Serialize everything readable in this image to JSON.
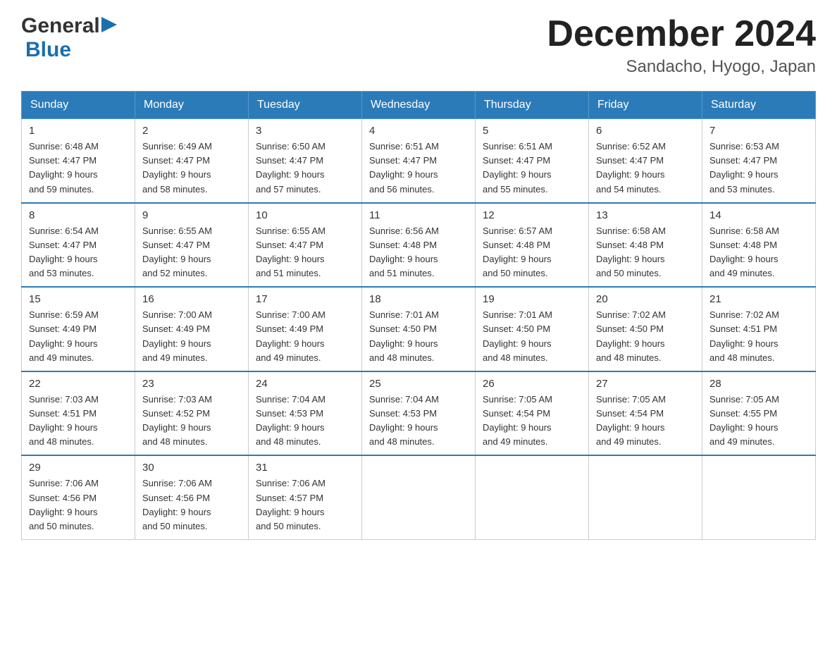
{
  "header": {
    "logo_general": "General",
    "logo_blue": "Blue",
    "month_title": "December 2024",
    "location": "Sandacho, Hyogo, Japan"
  },
  "weekdays": [
    "Sunday",
    "Monday",
    "Tuesday",
    "Wednesday",
    "Thursday",
    "Friday",
    "Saturday"
  ],
  "weeks": [
    [
      {
        "day": "1",
        "sunrise": "6:48 AM",
        "sunset": "4:47 PM",
        "daylight": "9 hours and 59 minutes."
      },
      {
        "day": "2",
        "sunrise": "6:49 AM",
        "sunset": "4:47 PM",
        "daylight": "9 hours and 58 minutes."
      },
      {
        "day": "3",
        "sunrise": "6:50 AM",
        "sunset": "4:47 PM",
        "daylight": "9 hours and 57 minutes."
      },
      {
        "day": "4",
        "sunrise": "6:51 AM",
        "sunset": "4:47 PM",
        "daylight": "9 hours and 56 minutes."
      },
      {
        "day": "5",
        "sunrise": "6:51 AM",
        "sunset": "4:47 PM",
        "daylight": "9 hours and 55 minutes."
      },
      {
        "day": "6",
        "sunrise": "6:52 AM",
        "sunset": "4:47 PM",
        "daylight": "9 hours and 54 minutes."
      },
      {
        "day": "7",
        "sunrise": "6:53 AM",
        "sunset": "4:47 PM",
        "daylight": "9 hours and 53 minutes."
      }
    ],
    [
      {
        "day": "8",
        "sunrise": "6:54 AM",
        "sunset": "4:47 PM",
        "daylight": "9 hours and 53 minutes."
      },
      {
        "day": "9",
        "sunrise": "6:55 AM",
        "sunset": "4:47 PM",
        "daylight": "9 hours and 52 minutes."
      },
      {
        "day": "10",
        "sunrise": "6:55 AM",
        "sunset": "4:47 PM",
        "daylight": "9 hours and 51 minutes."
      },
      {
        "day": "11",
        "sunrise": "6:56 AM",
        "sunset": "4:48 PM",
        "daylight": "9 hours and 51 minutes."
      },
      {
        "day": "12",
        "sunrise": "6:57 AM",
        "sunset": "4:48 PM",
        "daylight": "9 hours and 50 minutes."
      },
      {
        "day": "13",
        "sunrise": "6:58 AM",
        "sunset": "4:48 PM",
        "daylight": "9 hours and 50 minutes."
      },
      {
        "day": "14",
        "sunrise": "6:58 AM",
        "sunset": "4:48 PM",
        "daylight": "9 hours and 49 minutes."
      }
    ],
    [
      {
        "day": "15",
        "sunrise": "6:59 AM",
        "sunset": "4:49 PM",
        "daylight": "9 hours and 49 minutes."
      },
      {
        "day": "16",
        "sunrise": "7:00 AM",
        "sunset": "4:49 PM",
        "daylight": "9 hours and 49 minutes."
      },
      {
        "day": "17",
        "sunrise": "7:00 AM",
        "sunset": "4:49 PM",
        "daylight": "9 hours and 49 minutes."
      },
      {
        "day": "18",
        "sunrise": "7:01 AM",
        "sunset": "4:50 PM",
        "daylight": "9 hours and 48 minutes."
      },
      {
        "day": "19",
        "sunrise": "7:01 AM",
        "sunset": "4:50 PM",
        "daylight": "9 hours and 48 minutes."
      },
      {
        "day": "20",
        "sunrise": "7:02 AM",
        "sunset": "4:50 PM",
        "daylight": "9 hours and 48 minutes."
      },
      {
        "day": "21",
        "sunrise": "7:02 AM",
        "sunset": "4:51 PM",
        "daylight": "9 hours and 48 minutes."
      }
    ],
    [
      {
        "day": "22",
        "sunrise": "7:03 AM",
        "sunset": "4:51 PM",
        "daylight": "9 hours and 48 minutes."
      },
      {
        "day": "23",
        "sunrise": "7:03 AM",
        "sunset": "4:52 PM",
        "daylight": "9 hours and 48 minutes."
      },
      {
        "day": "24",
        "sunrise": "7:04 AM",
        "sunset": "4:53 PM",
        "daylight": "9 hours and 48 minutes."
      },
      {
        "day": "25",
        "sunrise": "7:04 AM",
        "sunset": "4:53 PM",
        "daylight": "9 hours and 48 minutes."
      },
      {
        "day": "26",
        "sunrise": "7:05 AM",
        "sunset": "4:54 PM",
        "daylight": "9 hours and 49 minutes."
      },
      {
        "day": "27",
        "sunrise": "7:05 AM",
        "sunset": "4:54 PM",
        "daylight": "9 hours and 49 minutes."
      },
      {
        "day": "28",
        "sunrise": "7:05 AM",
        "sunset": "4:55 PM",
        "daylight": "9 hours and 49 minutes."
      }
    ],
    [
      {
        "day": "29",
        "sunrise": "7:06 AM",
        "sunset": "4:56 PM",
        "daylight": "9 hours and 50 minutes."
      },
      {
        "day": "30",
        "sunrise": "7:06 AM",
        "sunset": "4:56 PM",
        "daylight": "9 hours and 50 minutes."
      },
      {
        "day": "31",
        "sunrise": "7:06 AM",
        "sunset": "4:57 PM",
        "daylight": "9 hours and 50 minutes."
      },
      null,
      null,
      null,
      null
    ]
  ],
  "labels": {
    "sunrise": "Sunrise:",
    "sunset": "Sunset:",
    "daylight": "Daylight:"
  }
}
